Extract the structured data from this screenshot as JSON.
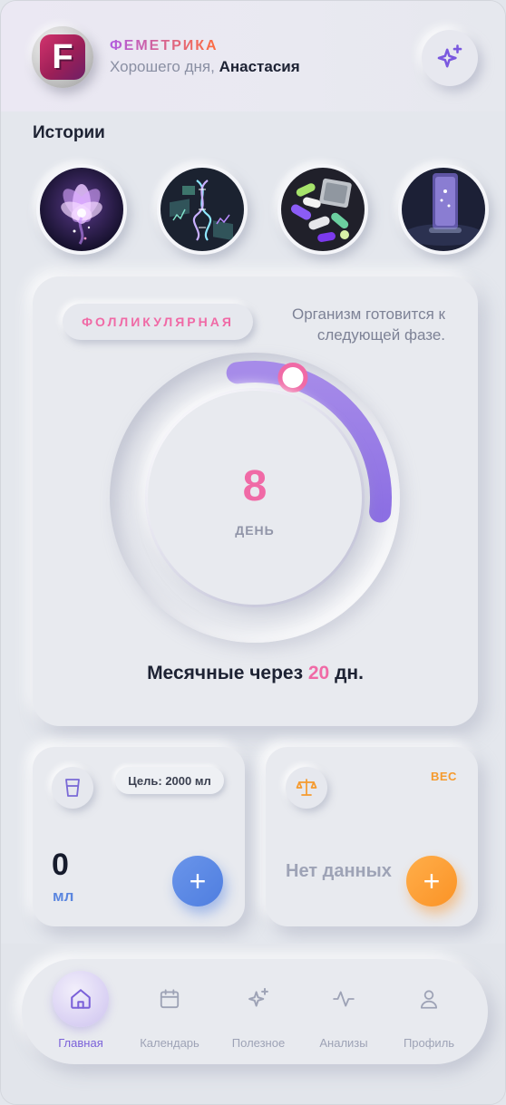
{
  "header": {
    "brand": "ФЕМЕТРИКА",
    "greeting_prefix": "Хорошего дня,",
    "user_name": "Анастасия",
    "logo_letter": "F",
    "action_icon": "sparkles-icon"
  },
  "stories": {
    "title": "Истории",
    "items": [
      {
        "subject": "lotus-flower"
      },
      {
        "subject": "dna-charts"
      },
      {
        "subject": "pills"
      },
      {
        "subject": "smartphone"
      }
    ]
  },
  "cycle": {
    "phase": "ФОЛЛИКУЛЯРНАЯ",
    "description": "Организм готовится к следующей фазе.",
    "day_number": "8",
    "day_label": "ДЕНЬ",
    "period_prefix": "Месячные через",
    "period_days": "20",
    "period_suffix": "дн.",
    "progress_fraction": 0.29
  },
  "water": {
    "icon": "glass-icon",
    "goal": "Цель: 2000 мл",
    "value": "0",
    "unit": "мл",
    "add": "+"
  },
  "weight": {
    "icon": "scales-icon",
    "title": "ВЕС",
    "empty_text": "Нет данных",
    "add": "+"
  },
  "nav": {
    "items": [
      {
        "label": "Главная",
        "icon": "home-icon",
        "active": true
      },
      {
        "label": "Календарь",
        "icon": "calendar-icon",
        "active": false
      },
      {
        "label": "Полезное",
        "icon": "sparkles-icon",
        "active": false
      },
      {
        "label": "Анализы",
        "icon": "pulse-icon",
        "active": false
      },
      {
        "label": "Профиль",
        "icon": "user-icon",
        "active": false
      }
    ]
  },
  "colors": {
    "accent_pink": "#f06aa6",
    "accent_purple": "#9b7be3",
    "water_blue": "#5b86df",
    "weight_orange": "#f59a2e",
    "text_dark": "#1d2233"
  }
}
